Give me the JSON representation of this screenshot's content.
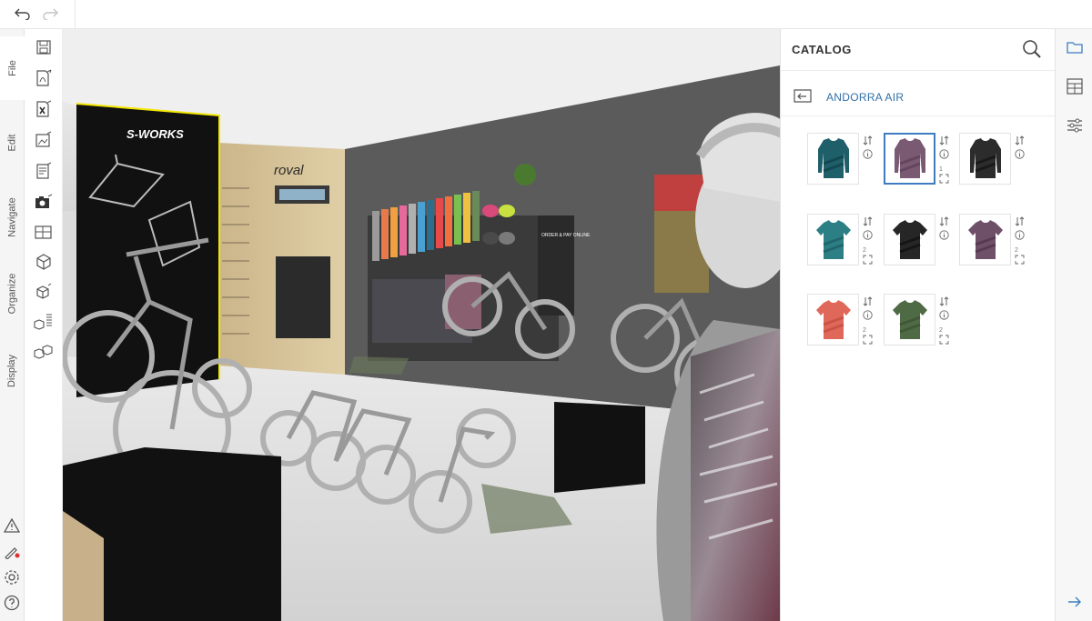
{
  "menu_tabs": [
    {
      "label": "File"
    },
    {
      "label": "Edit"
    },
    {
      "label": "Navigate"
    },
    {
      "label": "Organize"
    },
    {
      "label": "Display"
    }
  ],
  "scene": {
    "brand_panel_text": "S-WORKS",
    "wall_logo_text": "roval",
    "poster_text": "ORDER & PAY ONLINE"
  },
  "catalog": {
    "title": "CATALOG",
    "folder": "ANDORRA AIR",
    "items": [
      {
        "name": "long-sleeve-jersey-teal",
        "color": "#1f5f6a",
        "accent": "#0d3f48",
        "sleeve": "long",
        "selected": false,
        "count": ""
      },
      {
        "name": "long-sleeve-jersey-plum",
        "color": "#7a5a72",
        "accent": "#5b3d55",
        "sleeve": "long",
        "selected": true,
        "count": "1"
      },
      {
        "name": "long-sleeve-jersey-black",
        "color": "#2c2c2c",
        "accent": "#111111",
        "sleeve": "long",
        "selected": false,
        "count": ""
      },
      {
        "name": "short-sleeve-jersey-teal",
        "color": "#2d7f86",
        "accent": "#1b5c62",
        "sleeve": "short",
        "selected": false,
        "count": "2"
      },
      {
        "name": "short-sleeve-jersey-black",
        "color": "#262626",
        "accent": "#0f0f0f",
        "sleeve": "short",
        "selected": false,
        "count": ""
      },
      {
        "name": "short-sleeve-jersey-plum",
        "color": "#6e5068",
        "accent": "#4f3349",
        "sleeve": "short",
        "selected": false,
        "count": "2"
      },
      {
        "name": "short-sleeve-jersey-coral",
        "color": "#e0685a",
        "accent": "#c24a3e",
        "sleeve": "short",
        "selected": false,
        "count": "2"
      },
      {
        "name": "short-sleeve-jersey-green",
        "color": "#4f6b45",
        "accent": "#3a5132",
        "sleeve": "short",
        "selected": false,
        "count": "2"
      }
    ]
  },
  "colors": {
    "accent": "#3d7dbf",
    "folder_link": "#2f6fa6",
    "brand_yellow": "#f2e600"
  }
}
